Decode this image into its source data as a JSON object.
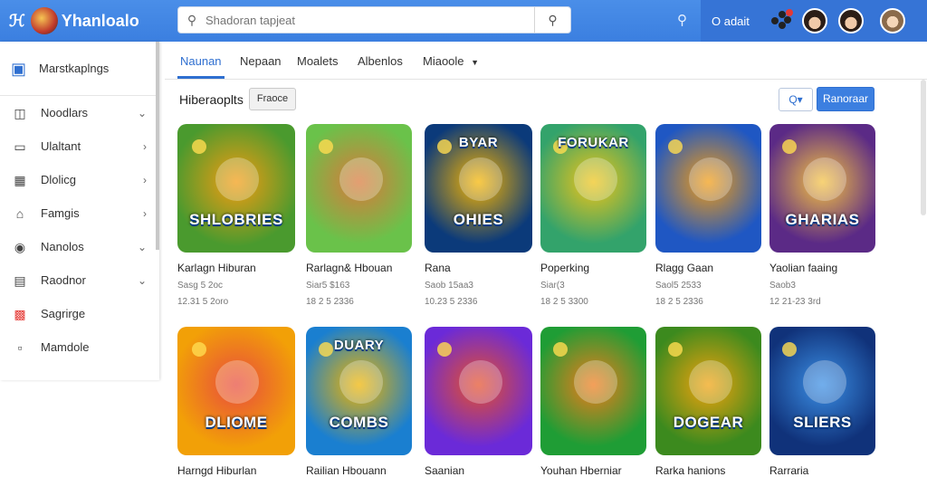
{
  "app": {
    "title": "Yhanloalo",
    "glyph": "ℋ"
  },
  "search": {
    "placeholder": "Shadoran tapjeat"
  },
  "topbar": {
    "link": "O adait"
  },
  "sidebar": {
    "header": "Marstkaplngs",
    "items": [
      {
        "label": "Noodlars",
        "icon": "folder-icon",
        "chevron": "⌄"
      },
      {
        "label": "Ulaltant",
        "icon": "monitor-icon",
        "chevron": "›"
      },
      {
        "label": "Dlolicg",
        "icon": "chart-icon",
        "chevron": "›"
      },
      {
        "label": "Famgis",
        "icon": "home-icon",
        "chevron": "›"
      },
      {
        "label": "Nanolos",
        "icon": "globe-icon",
        "chevron": "⌄"
      },
      {
        "label": "Raodnor",
        "icon": "card-icon",
        "chevron": "⌄"
      },
      {
        "label": "Sagrirge",
        "icon": "calendar-icon",
        "chevron": ""
      },
      {
        "label": "Mamdole",
        "icon": "box-icon",
        "chevron": ""
      }
    ]
  },
  "tabs": [
    {
      "label": "Naunan",
      "active": true
    },
    {
      "label": "Nepaan",
      "active": false
    },
    {
      "label": "Moalets",
      "active": false
    },
    {
      "label": "Albenlos",
      "active": false
    },
    {
      "label": "Miaoole",
      "active": false,
      "dropdown": true
    }
  ],
  "section": {
    "title": "Hiberaoplts",
    "filter_label": "Fraoce",
    "sort_label": "Q▾",
    "primary_label": "Ranoraar"
  },
  "cards": [
    {
      "title": "Karlagn Hiburan",
      "sub": "Sasg 5 2oc",
      "meta": "12.31 5 2oro",
      "thumb_text": "SHLOBRIES",
      "thumb_top": "",
      "colors": [
        "#4a9a2e",
        "#f39c12"
      ]
    },
    {
      "title": "Rarlagn& Hbouan",
      "sub": "Siar5 $163",
      "meta": "18 2 5 2336",
      "thumb_text": "",
      "thumb_top": "",
      "colors": [
        "#6ac24a",
        "#d9793b"
      ]
    },
    {
      "title": "Rana",
      "sub": "Saob 15aa3",
      "meta": "10.23 5 2336",
      "thumb_text": "OHIES",
      "thumb_top": "BYAR",
      "colors": [
        "#0b3a7a",
        "#f7b500"
      ]
    },
    {
      "title": "Poperking",
      "sub": "Siar(3",
      "meta": "18 2 5 3300",
      "thumb_text": "",
      "thumb_top": "FORUKAR",
      "colors": [
        "#33a36b",
        "#f0c419"
      ]
    },
    {
      "title": "Rlagg Gaan",
      "sub": "Saol5 2533",
      "meta": "18 2 5 2336",
      "thumb_text": "",
      "thumb_top": "",
      "colors": [
        "#1f57c3",
        "#f39c12"
      ]
    },
    {
      "title": "Yaolian faaing",
      "sub": "Saob3",
      "meta": "12 21-23 3rd",
      "thumb_text": "GHARIAS",
      "thumb_top": "",
      "colors": [
        "#5b2a86",
        "#f5c242"
      ]
    },
    {
      "title": "Harngd Hiburlan",
      "sub": "",
      "meta": "",
      "thumb_text": "DLIOME",
      "thumb_top": "",
      "colors": [
        "#f2a007",
        "#e84c3d"
      ]
    },
    {
      "title": "Railian Hbouann",
      "sub": "",
      "meta": "",
      "thumb_text": "COMBS",
      "thumb_top": "DUARY",
      "colors": [
        "#1a7fd0",
        "#f0b400"
      ]
    },
    {
      "title": "Saanian",
      "sub": "",
      "meta": "",
      "thumb_text": "",
      "thumb_top": "",
      "colors": [
        "#6b2ad8",
        "#e5502a"
      ]
    },
    {
      "title": "Youhan Hberniar",
      "sub": "",
      "meta": "",
      "thumb_text": "",
      "thumb_top": "",
      "colors": [
        "#1f9d35",
        "#f07b1b"
      ]
    },
    {
      "title": "Rarka hanions",
      "sub": "",
      "meta": "",
      "thumb_text": "DOGEAR",
      "thumb_top": "",
      "colors": [
        "#3c8a1e",
        "#f1a20d"
      ]
    },
    {
      "title": "Rarraria",
      "sub": "",
      "meta": "",
      "thumb_text": "SLIERS",
      "thumb_top": "",
      "colors": [
        "#10327a",
        "#3b8fe5"
      ]
    }
  ]
}
